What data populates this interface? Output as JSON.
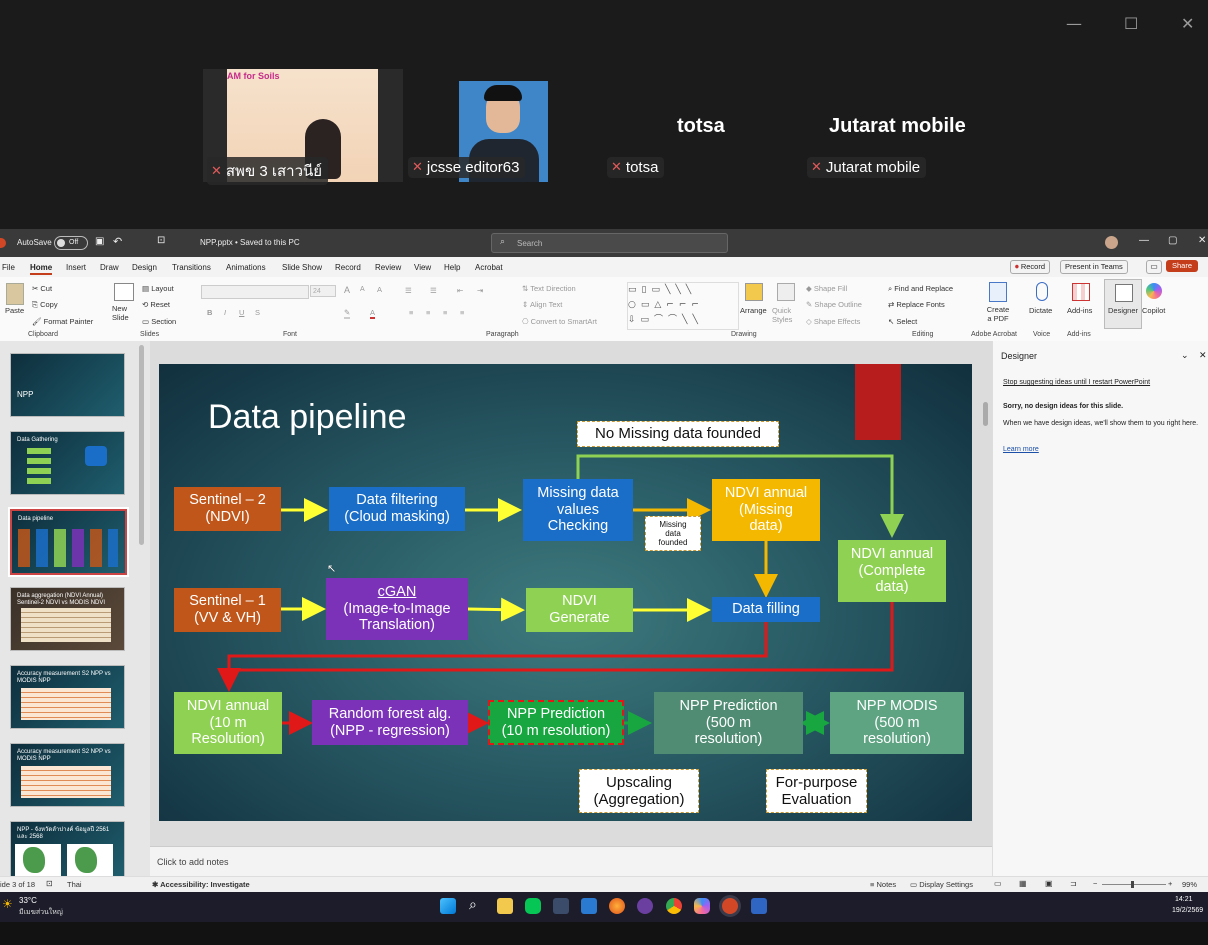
{
  "teams": {
    "participants": [
      {
        "name": "สพข 3 เสาวนีย์",
        "share_text": "AM for Soils"
      },
      {
        "name": "jcsse editor63"
      },
      {
        "name": "totsa",
        "display": "totsa"
      },
      {
        "name": "Jutarat mobile",
        "display": "Jutarat mobile"
      }
    ],
    "window_controls": [
      "—",
      "☐",
      "✕"
    ]
  },
  "ppt": {
    "autosave_label": "AutoSave",
    "autosave_state": "Off",
    "file_title": "NPP.pptx • Saved to this PC",
    "search_placeholder": "Search",
    "menu": [
      "File",
      "Home",
      "Insert",
      "Draw",
      "Design",
      "Transitions",
      "Animations",
      "Slide Show",
      "Record",
      "Review",
      "View",
      "Help",
      "Acrobat"
    ],
    "record_button": "Record",
    "present_button": "Present in Teams",
    "share_button": "Share",
    "ribbon": {
      "clipboard": {
        "paste": "Paste",
        "cut": "Cut",
        "copy": "Copy",
        "format_painter": "Format Painter",
        "group": "Clipboard"
      },
      "slides": {
        "new_slide": "New Slide",
        "layout": "Layout",
        "reset": "Reset",
        "section": "Section",
        "group": "Slides"
      },
      "font_group": "Font",
      "font_size": "24",
      "paragraph": {
        "text_direction": "Text Direction",
        "align_text": "Align Text",
        "convert": "Convert to SmartArt",
        "group": "Paragraph"
      },
      "drawing": {
        "arrange": "Arrange",
        "quick_styles": "Quick Styles",
        "shape_fill": "Shape Fill",
        "shape_outline": "Shape Outline",
        "shape_effects": "Shape Effects",
        "group": "Drawing"
      },
      "editing": {
        "find": "Find and Replace",
        "replace": "Replace Fonts",
        "select": "Select",
        "group": "Editing"
      },
      "acrobat": {
        "create_pdf": "Create a PDF",
        "group": "Adobe Acrobat"
      },
      "voice": {
        "dictate": "Dictate",
        "group": "Voice"
      },
      "addins": {
        "label": "Add-ins",
        "group": "Add-ins"
      },
      "designer": "Designer",
      "copilot": "Copilot"
    },
    "thumbnails": [
      {
        "title": "NPP"
      },
      {
        "title": "Data Gathering"
      },
      {
        "title": "Data pipeline"
      },
      {
        "title": "Data aggregation (NDVI Annual) Sentinel-2 NDVI vs MODIS NDVI"
      },
      {
        "title": "Accuracy measurement S2 NPP vs MODIS NPP"
      },
      {
        "title": "Accuracy measurement S2 NPP vs MODIS NPP"
      },
      {
        "title": "NPP - จังหวัดลำปางค์ ข้อมูลปี 2561 และ 2568"
      }
    ],
    "slide": {
      "title": "Data pipeline",
      "boxes": {
        "s2": "Sentinel – 2\n(NDVI)",
        "filter": "Data filtering\n(Cloud masking)",
        "missing_check": "Missing data\nvalues\nChecking",
        "ndvi_missing": "NDVI annual\n(Missing\ndata)",
        "ndvi_complete": "NDVI annual\n(Complete\ndata)",
        "s1": "Sentinel – 1\n(VV & VH)",
        "cgan_title": "cGAN",
        "cgan_sub": "(Image-to-Image\nTranslation)",
        "ndvi_gen": "NDVI\nGenerate",
        "filling": "Data filling",
        "ndvi_10m": "NDVI annual\n(10 m\nResolution)",
        "rf": "Random forest alg.\n(NPP - regression)",
        "npp_pred10": "NPP Prediction\n(10 m resolution)",
        "npp_pred500": "NPP Prediction\n(500 m\nresolution)",
        "npp_modis": "NPP MODIS\n(500 m\nresolution)"
      },
      "notes": {
        "no_missing": "No Missing data founded",
        "missing_founded": "Missing\ndata\nfounded",
        "upscaling": "Upscaling\n(Aggregation)",
        "evaluation": "For-purpose\nEvaluation"
      }
    },
    "notes_placeholder": "Click to add notes",
    "designer": {
      "title": "Designer",
      "stop_link": "Stop suggesting ideas until I restart PowerPoint",
      "sorry": "Sorry, no design ideas for this slide.",
      "body": "When we have design ideas, we'll show them to you right here.",
      "learn_more": "Learn more"
    },
    "status": {
      "slide_counter": "ide 3 of 18",
      "language": "Thai",
      "accessibility": "Accessibility: Investigate",
      "notes": "Notes",
      "display_settings": "Display Settings",
      "zoom": "99%"
    }
  },
  "taskbar": {
    "weather_temp": "33°C",
    "weather_desc": "มีเมฆส่วนใหญ่",
    "time": "14:21",
    "date": "19/2/2569"
  }
}
